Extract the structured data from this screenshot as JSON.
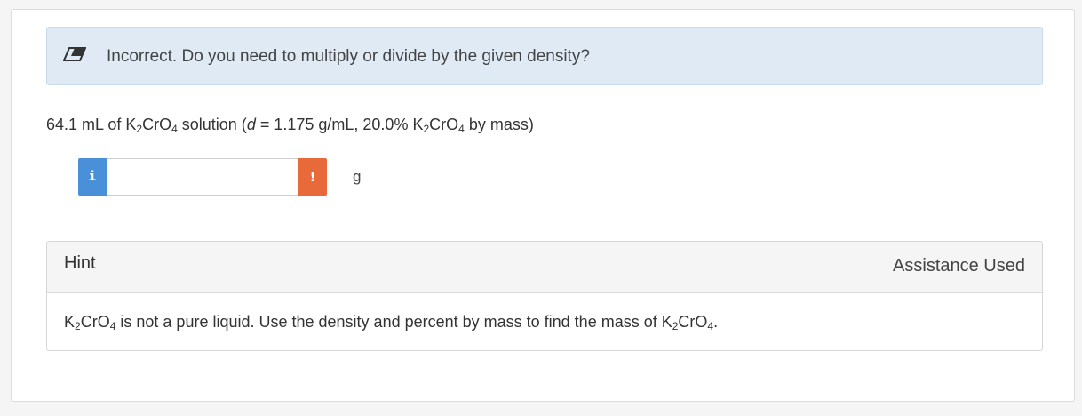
{
  "feedback": {
    "icon": "eraser-icon",
    "message": "Incorrect. Do you need to multiply or divide by the given density?"
  },
  "question": {
    "volume": "64.1 mL of K",
    "formula_parts": [
      "K",
      "2",
      "CrO",
      "4"
    ],
    "text_a": "64.1 mL of K",
    "sub_a": "2",
    "text_b": "CrO",
    "sub_b": "4",
    "text_c": " solution (",
    "density_symbol": "d",
    "text_d": " = 1.175 g/mL, 20.0% K",
    "sub_c": "2",
    "text_e": "CrO",
    "sub_d": "4",
    "text_f": " by mass)"
  },
  "answer": {
    "info_icon": "i",
    "value": "",
    "alert_icon": "!",
    "unit": "g",
    "colors": {
      "info": "#4a90d9",
      "alert": "#e8693a"
    }
  },
  "hint": {
    "title": "Hint",
    "status": "Assistance Used",
    "t1": "K",
    "s1": "2",
    "t2": "CrO",
    "s2": "4",
    "t3": " is not a pure liquid. Use the density and percent by mass to find the mass of K",
    "s3": "2",
    "t4": "CrO",
    "s4": "4",
    "t5": "."
  }
}
